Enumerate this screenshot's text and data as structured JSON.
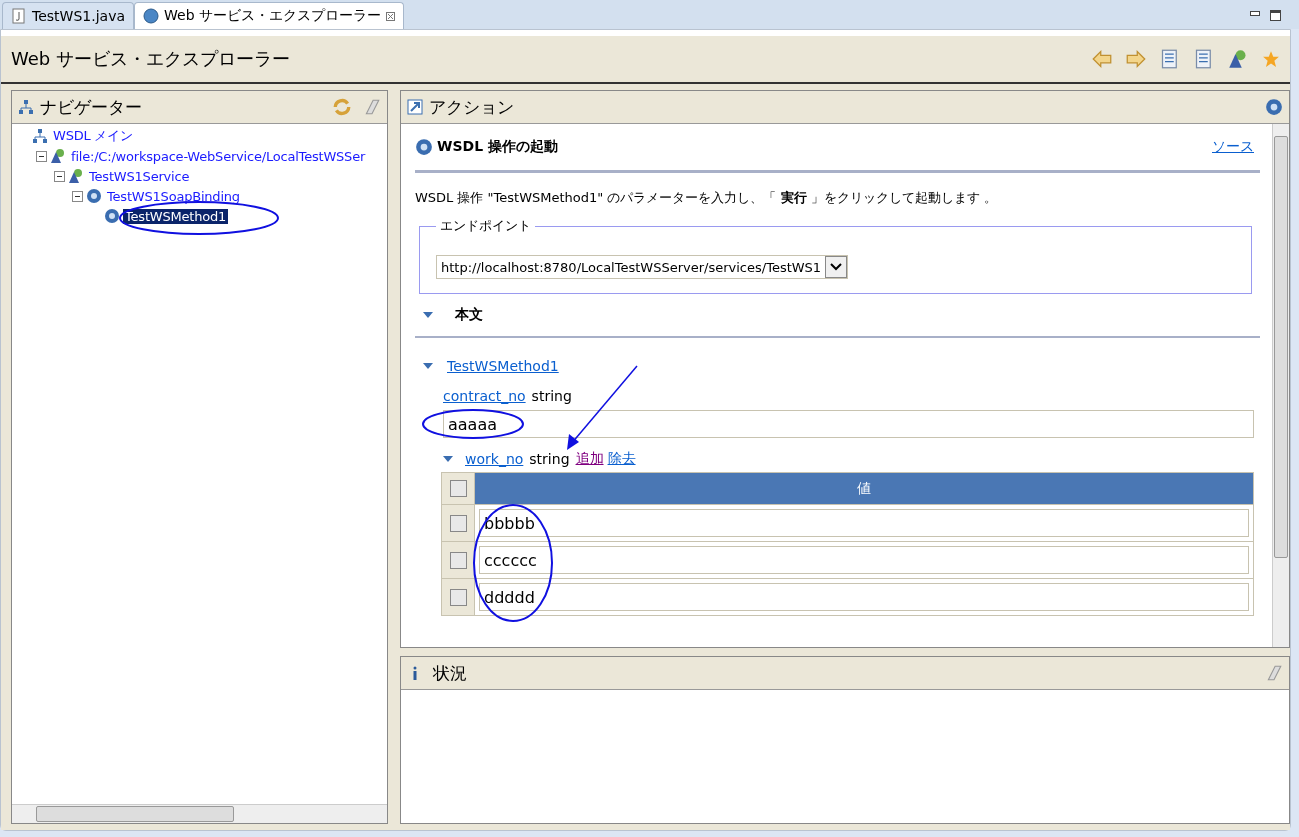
{
  "editor_tabs": [
    {
      "label": "TestWS1.java",
      "kind": "java",
      "selected": false
    },
    {
      "label": "Web サービス・エクスプローラー",
      "kind": "globe",
      "selected": true
    }
  ],
  "title": "Web サービス・エクスプローラー",
  "navigator": {
    "title": "ナビゲーター",
    "tree": [
      {
        "label": "WSDL メイン",
        "kind": "wsdl",
        "selected": false,
        "children": [
          {
            "label": "file:/C:/workspace-WebService/LocalTestWSSer",
            "kind": "service",
            "expanded": true,
            "selected": false,
            "children": [
              {
                "label": "TestWS1Service",
                "kind": "service",
                "expanded": true,
                "selected": false,
                "children": [
                  {
                    "label": "TestWS1SoapBinding",
                    "kind": "binding",
                    "expanded": true,
                    "selected": false,
                    "children": [
                      {
                        "label": "TestWSMethod1",
                        "kind": "operation",
                        "selected": true
                      }
                    ]
                  }
                ]
              }
            ]
          }
        ]
      }
    ]
  },
  "actions": {
    "title": "アクション",
    "heading": "WSDL 操作の起動",
    "source_link": "ソース",
    "description": "WSDL 操作 \"TestWSMethod1\" のパラメーターを入力し、「 **実行** 」をクリックして起動します 。",
    "endpoint": {
      "legend": "エンドポイント",
      "value": "http://localhost:8780/LocalTestWSServer/services/TestWS1"
    },
    "body_section": {
      "title": "本文",
      "expanded": true
    },
    "method": {
      "link": "TestWSMethod1",
      "expanded": true
    },
    "contract_no": {
      "link": "contract_no",
      "type": "string",
      "value": "aaaaa"
    },
    "work_no": {
      "link": "work_no",
      "type": "string",
      "expanded": true,
      "add_link": "追加",
      "remove_link": "除去",
      "header": "値",
      "header_checked": false,
      "rows": [
        {
          "value": "bbbbb",
          "checked": false
        },
        {
          "value": "cccccc",
          "checked": false
        },
        {
          "value": "ddddd",
          "checked": false
        }
      ]
    }
  },
  "status": {
    "title": "状況"
  }
}
